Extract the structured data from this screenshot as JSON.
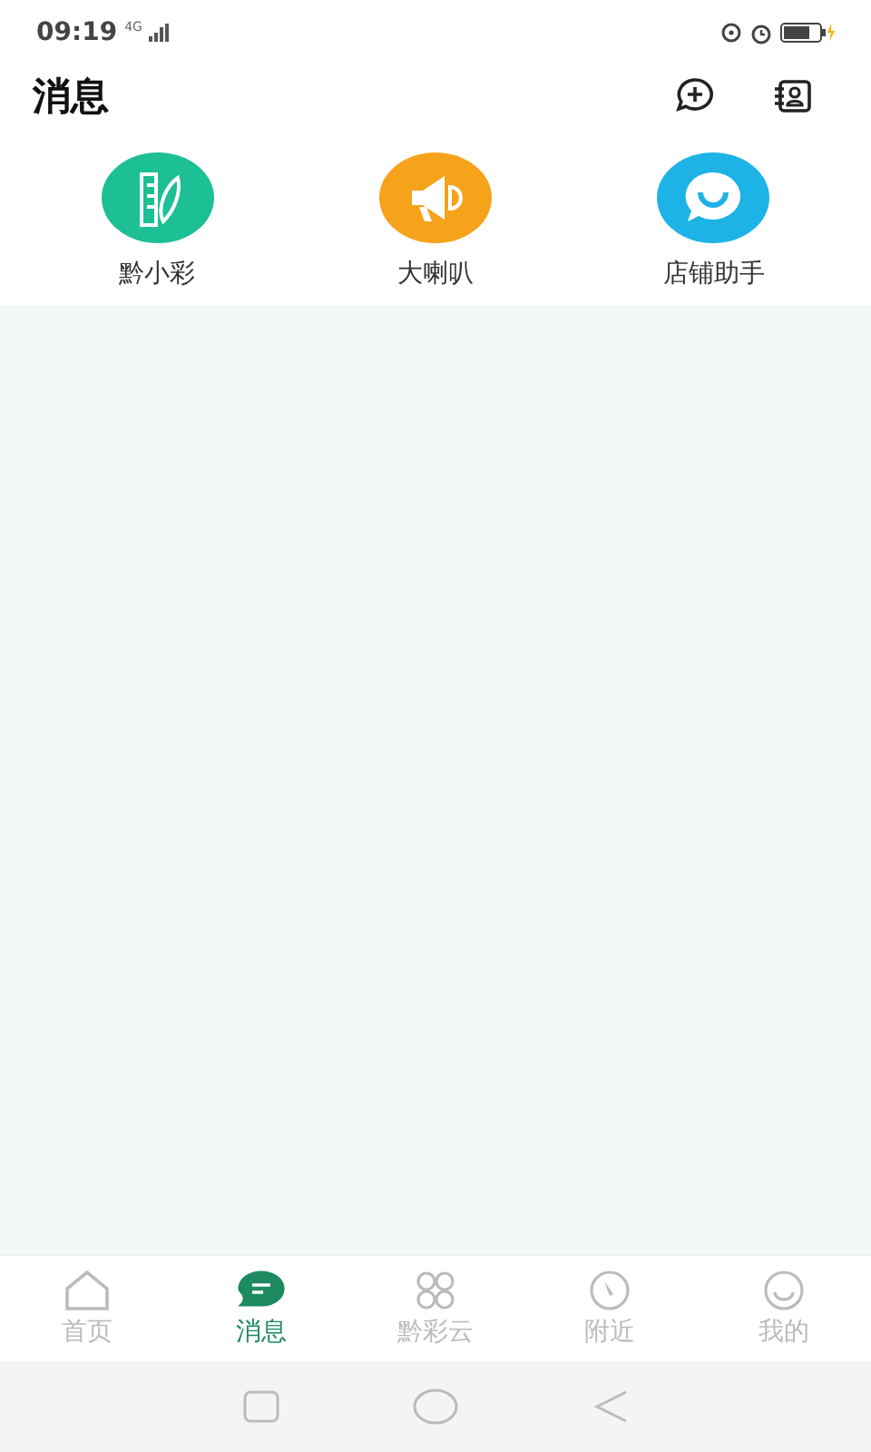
{
  "status_bar": {
    "time": "09:19",
    "network": "4G"
  },
  "header": {
    "title": "消息"
  },
  "shortcuts": [
    {
      "label": "黔小彩",
      "kind": "leaf",
      "color": "#1dbf94"
    },
    {
      "label": "大喇叭",
      "kind": "megaphone",
      "color": "#f6a21a"
    },
    {
      "label": "店铺助手",
      "kind": "chat",
      "color": "#1eb3e6"
    }
  ],
  "tab_bar": [
    {
      "label": "首页",
      "kind": "home",
      "selected": false
    },
    {
      "label": "消息",
      "kind": "message",
      "selected": true
    },
    {
      "label": "黔彩云",
      "kind": "grid",
      "selected": false
    },
    {
      "label": "附近",
      "kind": "compass",
      "selected": false
    },
    {
      "label": "我的",
      "kind": "smile",
      "selected": false
    }
  ]
}
